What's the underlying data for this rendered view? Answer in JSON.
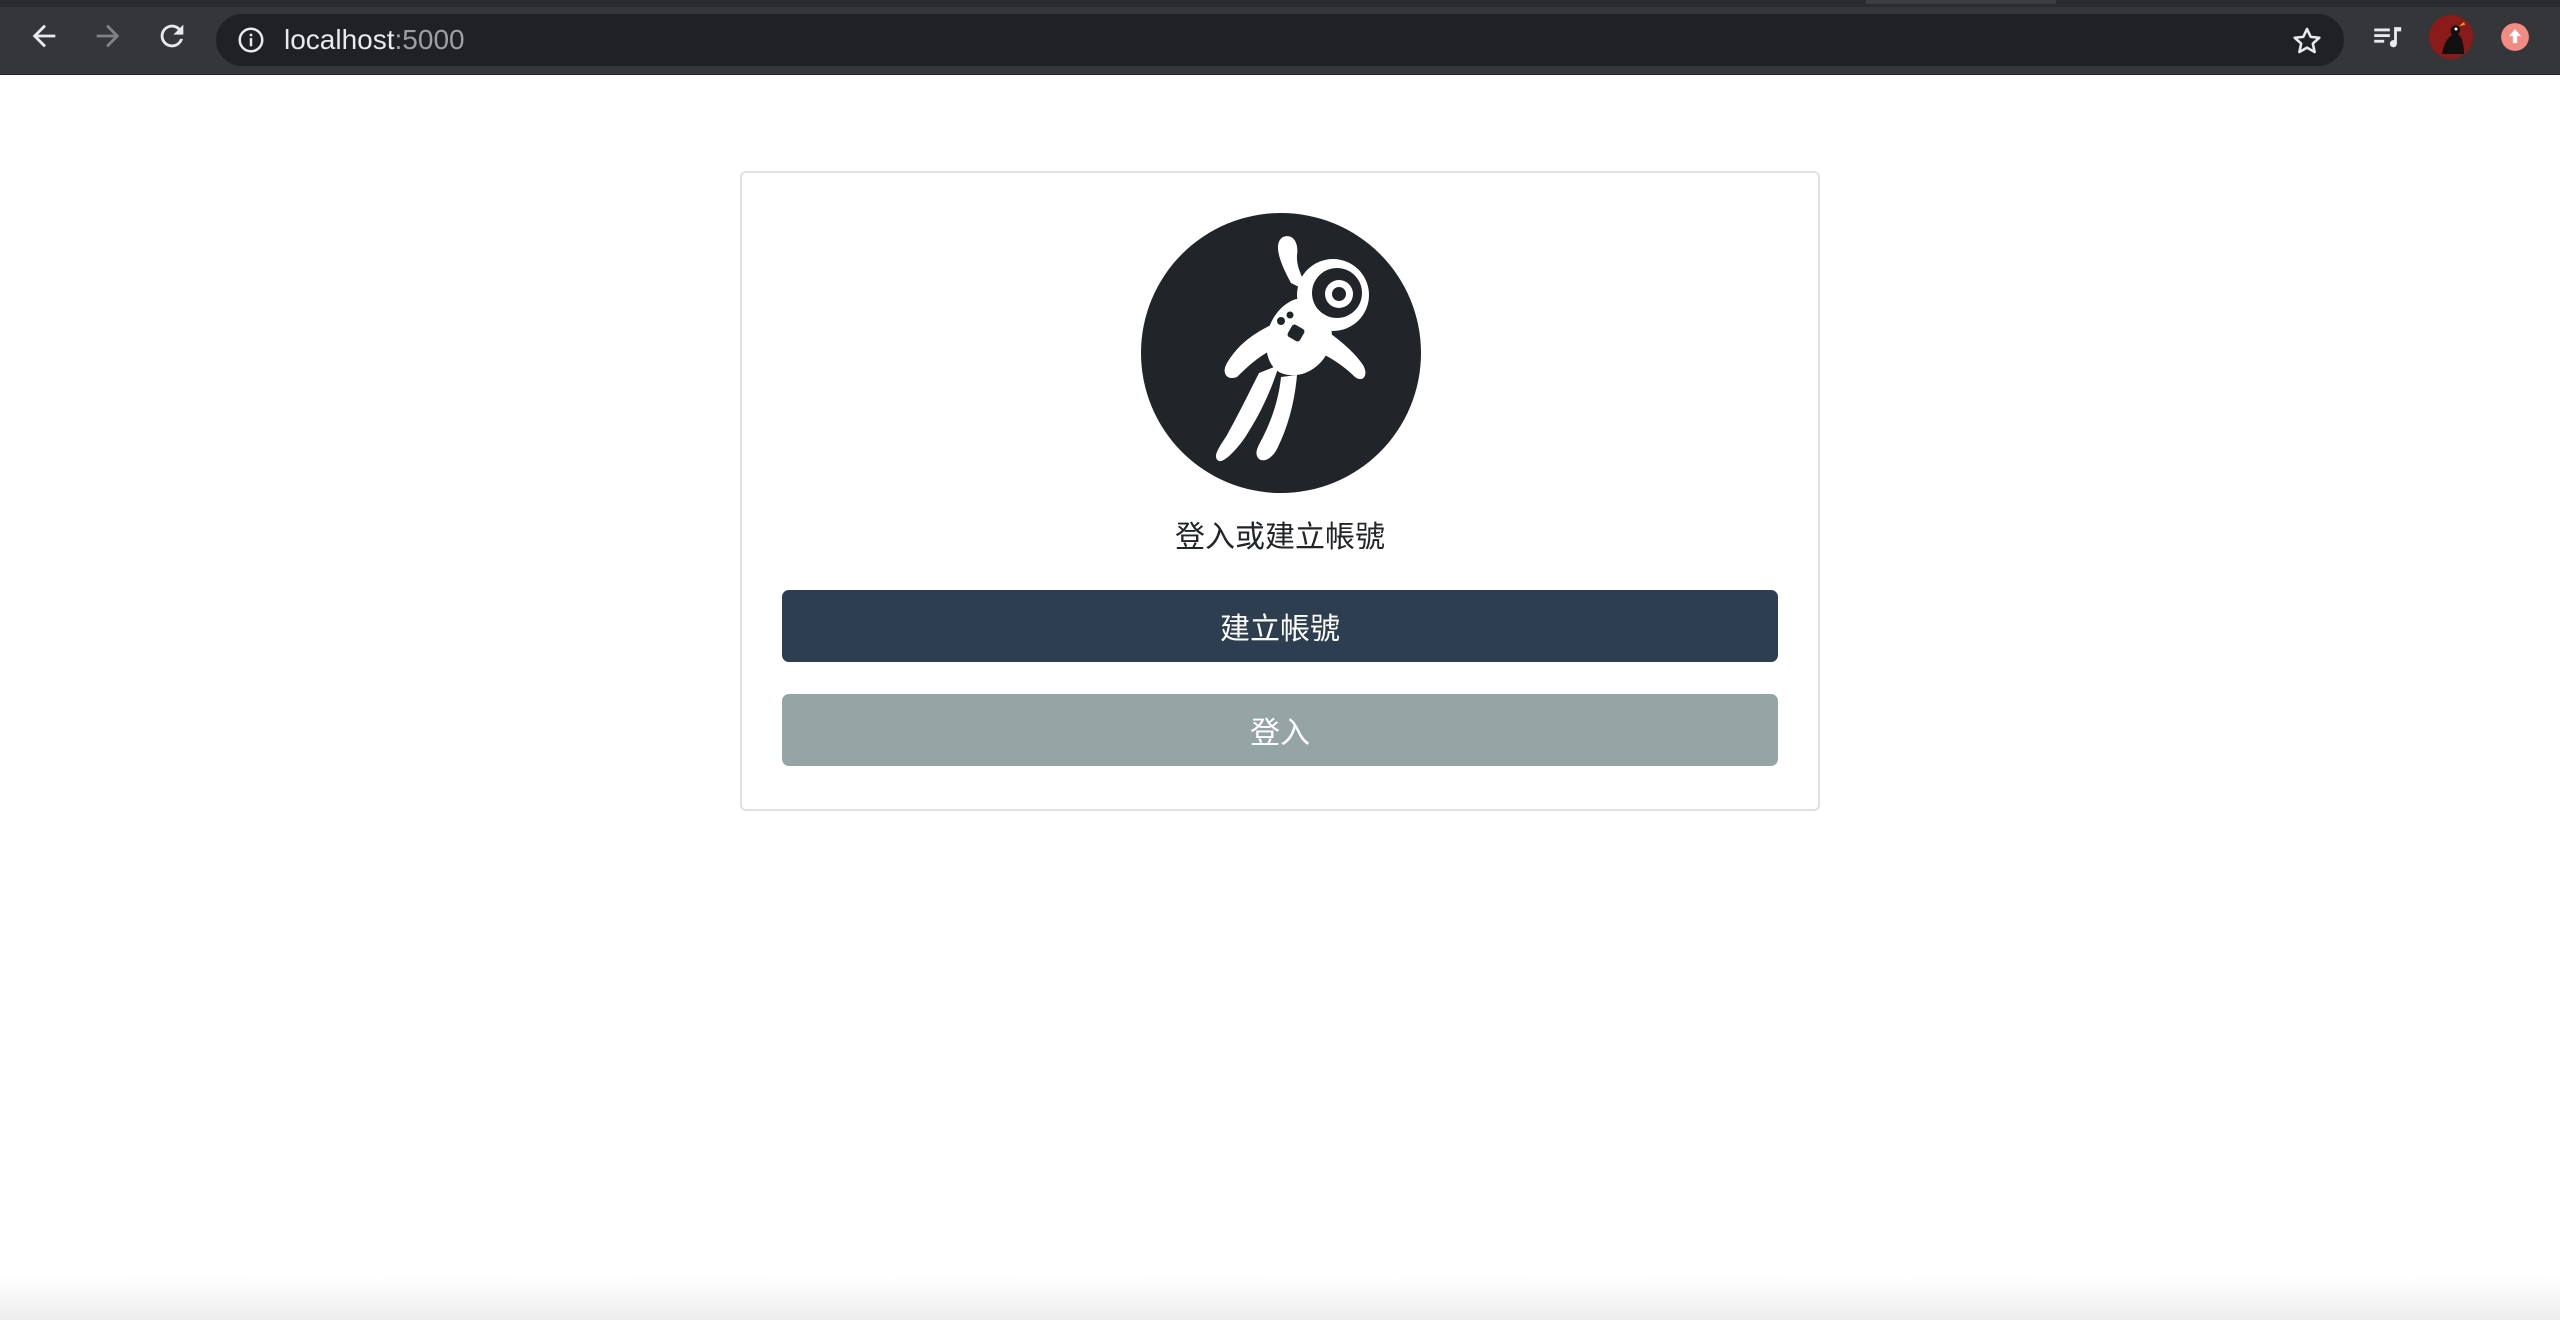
{
  "browser": {
    "url_host": "localhost",
    "url_port": ":5000",
    "icons": {
      "back": "back-arrow-icon",
      "forward": "forward-arrow-icon",
      "reload": "reload-icon",
      "info": "info-icon",
      "bookmark": "star-icon",
      "reading_list": "reading-list-icon",
      "profile": "profile-avatar",
      "update": "update-icon"
    }
  },
  "card": {
    "title": "登入或建立帳號",
    "avatar_icon": "astronaut-icon",
    "create_label": "建立帳號",
    "login_label": "登入"
  },
  "colors": {
    "primary_button": "#2c3e50",
    "secondary_button": "#95a5a6",
    "avatar_bg": "#212529",
    "chrome_bg": "#35363a"
  }
}
